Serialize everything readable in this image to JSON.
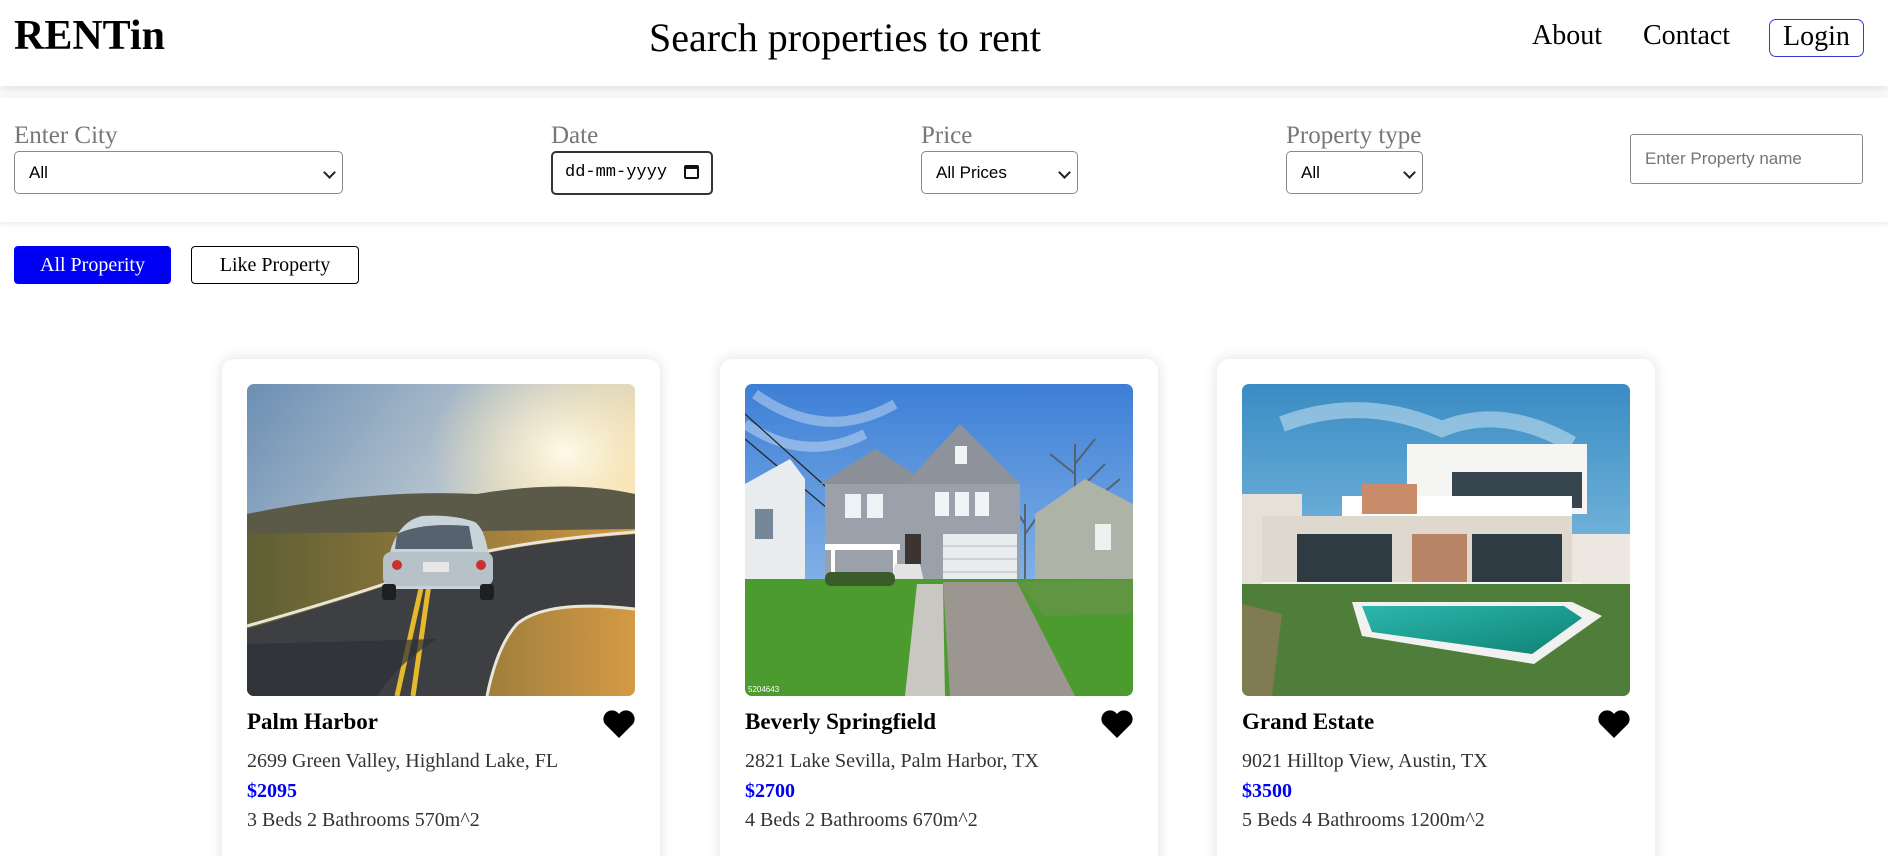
{
  "header": {
    "brand": "RENTin",
    "title": "Search properties to rent",
    "nav": {
      "about": "About",
      "contact": "Contact",
      "login": "Login"
    }
  },
  "filters": {
    "city": {
      "label": "Enter City",
      "value": "All"
    },
    "date": {
      "label": "Date",
      "placeholder": "dd-mm-yyyy"
    },
    "price": {
      "label": "Price",
      "value": "All Prices"
    },
    "property_type": {
      "label": "Property type",
      "value": "All"
    },
    "property_name": {
      "placeholder": "Enter Property name"
    }
  },
  "tabs": {
    "all": "All Properity",
    "like": "Like Property"
  },
  "accent_color": "#0000f5",
  "properties": [
    {
      "name": "Palm Harbor",
      "address": "2699 Green Valley, Highland Lake, FL",
      "price": "$2095",
      "specs": "3 Beds 2 Bathrooms 570m^2",
      "image": "sports car on a winding road at sunset",
      "liked": true
    },
    {
      "name": "Beverly Springfield",
      "address": "2821 Lake Sevilla, Palm Harbor, TX",
      "price": "$2700",
      "specs": "4 Beds 2 Bathrooms 670m^2",
      "image": "grey two-storey suburban house",
      "image_caption": "5204643",
      "liked": true
    },
    {
      "name": "Grand Estate",
      "address": "9021 Hilltop View, Austin, TX",
      "price": "$3500",
      "specs": "5 Beds 4 Bathrooms 1200m^2",
      "image": "modern villa with swimming pool",
      "liked": true
    }
  ]
}
